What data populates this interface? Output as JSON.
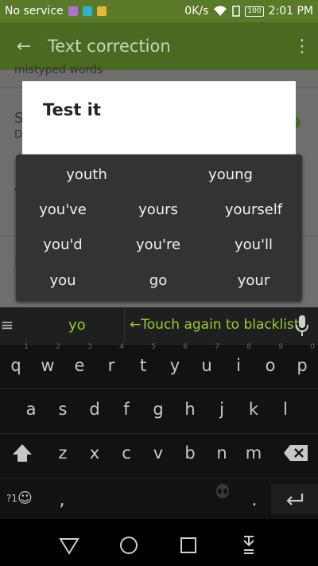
{
  "status": {
    "carrier": "No service",
    "speed": "0K/s",
    "battery": "100",
    "time": "2:01 PM"
  },
  "appbar": {
    "title": "Text correction"
  },
  "background": {
    "row1": "mistyped words",
    "row2_initial": "S",
    "row2_sub": "D",
    "row3_initial": "A",
    "row4_initial": "I"
  },
  "dialog": {
    "title": "Test it"
  },
  "suggestions": [
    {
      "label": "youth"
    },
    {
      "label": "young"
    },
    {
      "label": "you've"
    },
    {
      "label": "yours"
    },
    {
      "label": "yourself"
    },
    {
      "label": "you'd"
    },
    {
      "label": "you're"
    },
    {
      "label": "you'll"
    },
    {
      "label": "you"
    },
    {
      "label": "go"
    },
    {
      "label": "your"
    }
  ],
  "strip": {
    "typed": "yo",
    "hint": "←Touch again to blacklist"
  },
  "keyboard": {
    "row1": [
      {
        "label": "q",
        "hint": "1"
      },
      {
        "label": "w",
        "hint": "2"
      },
      {
        "label": "e",
        "hint": "3"
      },
      {
        "label": "r",
        "hint": "4"
      },
      {
        "label": "t",
        "hint": "5"
      },
      {
        "label": "y",
        "hint": "6"
      },
      {
        "label": "u",
        "hint": "7"
      },
      {
        "label": "i",
        "hint": "8"
      },
      {
        "label": "o",
        "hint": "9"
      },
      {
        "label": "p",
        "hint": "0"
      }
    ],
    "row2": [
      "a",
      "s",
      "d",
      "f",
      "g",
      "h",
      "j",
      "k",
      "l"
    ],
    "row3": [
      "z",
      "x",
      "c",
      "v",
      "b",
      "n",
      "m"
    ],
    "symbols": "?1",
    "comma": ",",
    "period": "."
  },
  "colors": {
    "accent": "#9acd32",
    "appbar": "#4a6a22",
    "statusbar": "#5a7a2a"
  }
}
